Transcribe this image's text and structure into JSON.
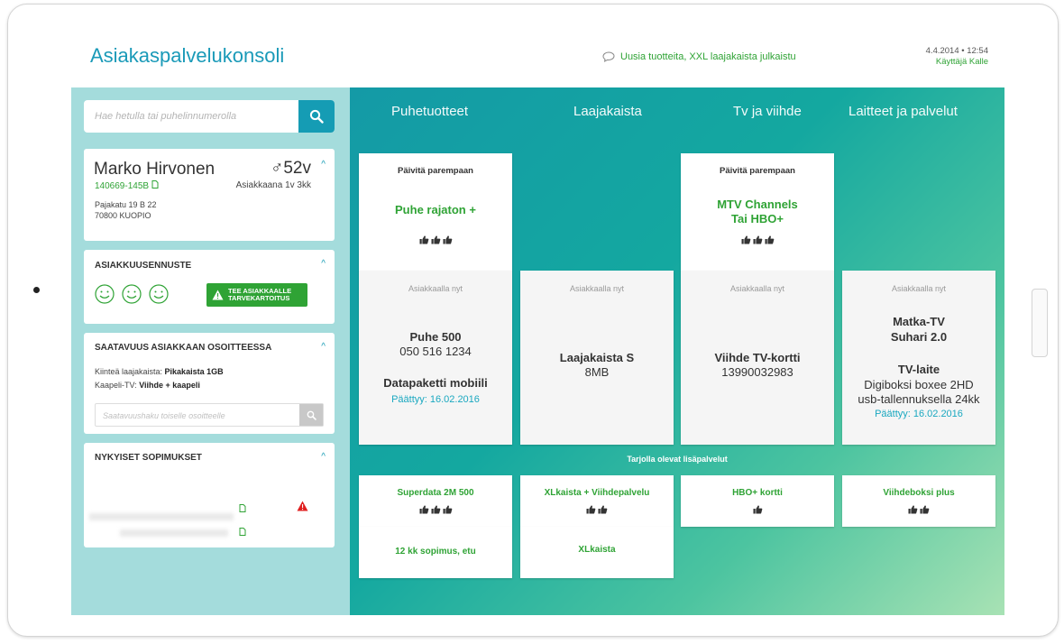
{
  "header": {
    "app_title": "Asiakaspalvelukonsoli",
    "news": "Uusia tuotteita, XXL laajakaista julkaistu",
    "datetime": "4.4.2014 • 12:54",
    "user": "Käyttäjä Kalle"
  },
  "search": {
    "placeholder": "Hae hetulla tai puhelinnumerolla"
  },
  "customer": {
    "name": "Marko Hirvonen",
    "gender_age": "♂52v",
    "id": "140669-145B",
    "since": "Asiakkaana 1v 3kk",
    "street": "Pajakatu 19 B 22",
    "city": "70800 KUOPIO"
  },
  "forecast": {
    "title": "ASIAKKUUSENNUSTE",
    "button_line1": "TEE ASIAKKAALLE",
    "button_line2": "TARVEKARTOITUS"
  },
  "availability": {
    "title": "SAATAVUUS ASIAKKAAN OSOITTEESSA",
    "fixed_label": "Kiinteä laajakaista: ",
    "fixed_value": "Pikakaista 1GB",
    "cable_label": "Kaapeli-TV: ",
    "cable_value": "Viihde + kaapeli",
    "search_placeholder": "Saatavuushaku toiselle osoitteelle"
  },
  "contracts": {
    "title": "NYKYISET SOPIMUKSET"
  },
  "tabs": [
    "Puhetuotteet",
    "Laajakaista",
    "Tv ja viihde",
    "Laitteet ja palvelut"
  ],
  "upgrades": [
    {
      "title": "Päivitä parempaan",
      "line1": "Puhe rajaton +",
      "line2": "",
      "rating": 3
    },
    {
      "title": "Päivitä parempaan",
      "line1": "MTV Channels",
      "line2": "Tai HBO+",
      "rating": 3
    }
  ],
  "current_label": "Asiakkaalla nyt",
  "current": {
    "phone": {
      "product": "Puhe 500",
      "number": "050 516 1234",
      "product2": "Datapaketti mobiili",
      "ended": "Päättyy: 16.02.2016"
    },
    "broadband": {
      "product": "Laajakaista S",
      "speed": "8MB"
    },
    "tv": {
      "product": "Viihde TV-kortti",
      "number": "13990032983"
    },
    "devices": {
      "product_line1": "Matka-TV",
      "product_line2": "Suhari 2.0",
      "device": "TV-laite",
      "desc1": "Digiboksi boxee 2HD",
      "desc2": "usb-tallennuksella 24kk",
      "ended": "Päättyy: 16.02.2016"
    }
  },
  "addons": {
    "title": "Tarjolla olevat lisäpalvelut",
    "items": [
      {
        "label": "Superdata 2M 500",
        "rating": 3
      },
      {
        "label": "XLkaista + Viihdepalvelu",
        "rating": 2
      },
      {
        "label": "HBO+ kortti",
        "rating": 1
      },
      {
        "label": "Viihdeboksi plus",
        "rating": 2
      }
    ],
    "row2": [
      "12 kk sopimus, etu",
      "XLkaista"
    ]
  },
  "colors": {
    "accent": "#1a9ab8",
    "green": "#2fa335",
    "sidebar": "#a4dcdc",
    "warning": "#e02020"
  }
}
